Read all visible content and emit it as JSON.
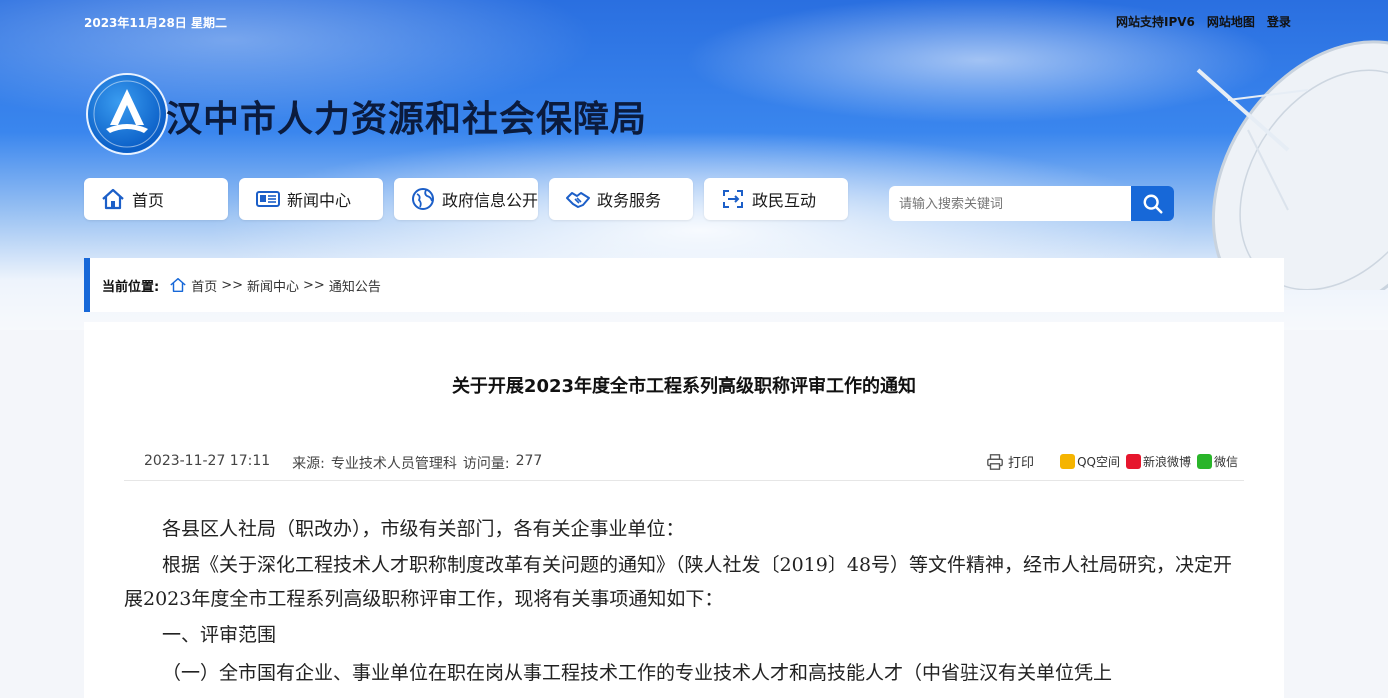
{
  "topbar": {
    "date": "2023年11月28日 星期二",
    "links": [
      "网站支持IPV6",
      "网站地图",
      "登录"
    ]
  },
  "site": {
    "title": "汉中市人力资源和社会保障局"
  },
  "nav": [
    {
      "label": "首页",
      "icon": "home-icon"
    },
    {
      "label": "新闻中心",
      "icon": "news-icon"
    },
    {
      "label": "政府信息公开",
      "icon": "globe-icon"
    },
    {
      "label": "政务服务",
      "icon": "handshake-icon"
    },
    {
      "label": "政民互动",
      "icon": "interaction-icon"
    }
  ],
  "search": {
    "placeholder": "请输入搜索关键词"
  },
  "breadcrumb": {
    "label": "当前位置:",
    "items": [
      "首页",
      "新闻中心",
      "通知公告"
    ],
    "separator": ">>"
  },
  "article": {
    "title": "关于开展2023年度全市工程系列高级职称评审工作的通知",
    "date": "2023-11-27 17:11",
    "source_label": "来源:",
    "source": "专业技术人员管理科",
    "views_label": "访问量:",
    "views": "277",
    "print_label": "打印",
    "share": [
      "QQ空间",
      "新浪微博",
      "微信"
    ],
    "paragraphs": [
      "各县区人社局（职改办），市级有关部门，各有关企事业单位：",
      "根据《关于深化工程技术人才职称制度改革有关问题的通知》（陕人社发〔2019〕48号）等文件精神，经市人社局研究，决定开展2023年度全市工程系列高级职称评审工作，现将有关事项通知如下：",
      "一、评审范围",
      "（一）全市国有企业、事业单位在职在岗从事工程技术工作的专业技术人才和高技能人才（中省驻汉有关单位凭上"
    ]
  },
  "colors": {
    "primary": "#1768d8",
    "title": "#0b1b3d"
  }
}
